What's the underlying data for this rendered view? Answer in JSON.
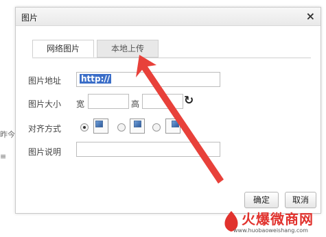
{
  "background": {
    "left_fragment": "昨今日",
    "left_glyph": "≡"
  },
  "dialog": {
    "title": "图片",
    "close_glyph": "×",
    "tabs": [
      {
        "label": "网络图片",
        "active": true
      },
      {
        "label": "本地上传",
        "active": false
      }
    ],
    "fields": {
      "url_label": "图片地址",
      "url_value": "http://",
      "size_label": "图片大小",
      "width_label": "宽",
      "height_label": "高",
      "align_label": "对齐方式",
      "caption_label": "图片说明"
    },
    "align_options": [
      "left",
      "center",
      "right"
    ],
    "align_selected": "left",
    "buttons": {
      "ok": "确定",
      "cancel": "取消"
    }
  },
  "watermark": {
    "text": "火爆微商网",
    "url": "www.huobaoweishang.com"
  },
  "colors": {
    "arrow": "#e8413a",
    "selection": "#3b6ec8",
    "watermark": "#e1322d"
  }
}
